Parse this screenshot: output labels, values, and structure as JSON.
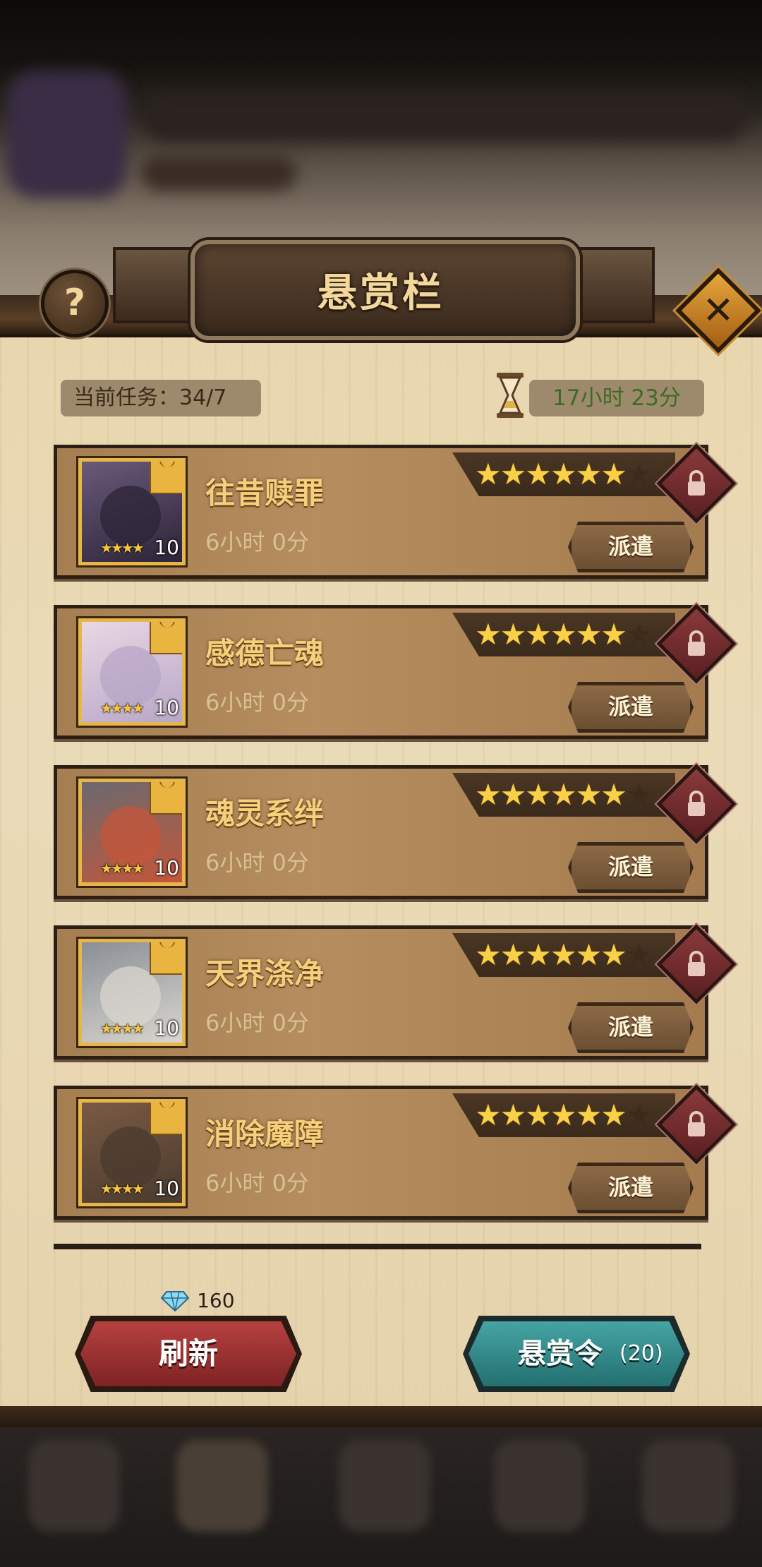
{
  "header": {
    "title": "悬赏栏"
  },
  "help_button": {
    "glyph": "?"
  },
  "close_button": {
    "glyph": "✕"
  },
  "task_info": {
    "label": "当前任务：",
    "value": "34/7"
  },
  "timer": {
    "value": "17小时 23分"
  },
  "bounties": [
    {
      "name": "往昔赎罪",
      "duration": "6小时 0分",
      "level": "10",
      "hero_stars": 4,
      "rating": 6,
      "rating_max": 7,
      "dispatch_label": "派遣",
      "locked": true
    },
    {
      "name": "感德亡魂",
      "duration": "6小时 0分",
      "level": "10",
      "hero_stars": 4,
      "rating": 6,
      "rating_max": 7,
      "dispatch_label": "派遣",
      "locked": true
    },
    {
      "name": "魂灵系绊",
      "duration": "6小时 0分",
      "level": "10",
      "hero_stars": 4,
      "rating": 6,
      "rating_max": 7,
      "dispatch_label": "派遣",
      "locked": true
    },
    {
      "name": "天界涤净",
      "duration": "6小时 0分",
      "level": "10",
      "hero_stars": 4,
      "rating": 6,
      "rating_max": 7,
      "dispatch_label": "派遣",
      "locked": true
    },
    {
      "name": "消除魔障",
      "duration": "6小时 0分",
      "level": "10",
      "hero_stars": 4,
      "rating": 6,
      "rating_max": 7,
      "dispatch_label": "派遣",
      "locked": true
    }
  ],
  "refresh": {
    "cost": "160",
    "label": "刷新"
  },
  "bounty_token": {
    "label": "悬赏令",
    "count": "(20)"
  },
  "colors": {
    "accent_gold": "#f7cf7a",
    "timer_green": "#3d6b26",
    "refresh_red": "#b6413f",
    "token_teal": "#46a4a4"
  }
}
